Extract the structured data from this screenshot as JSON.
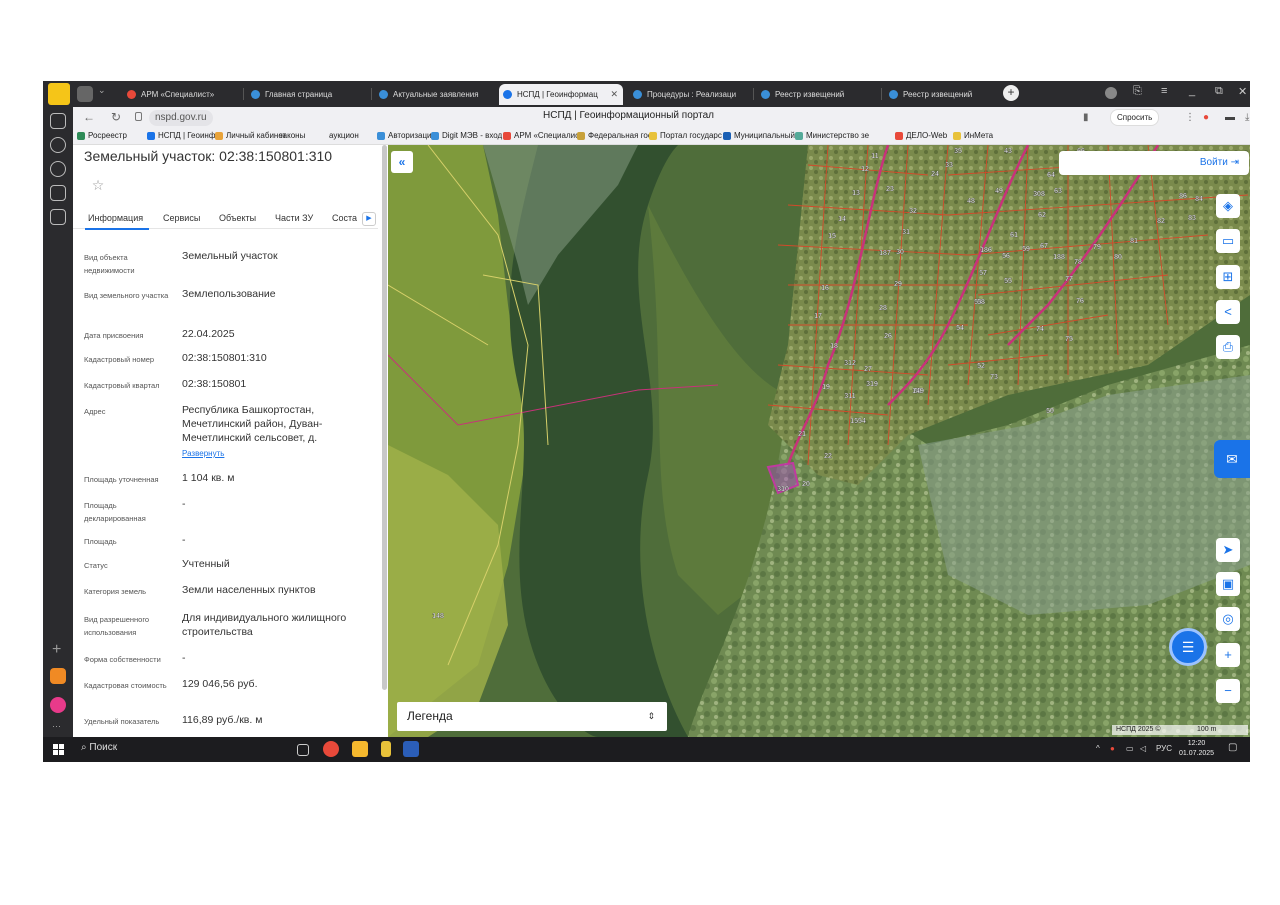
{
  "browser": {
    "tabs": [
      {
        "label": "АРМ «Специалист»",
        "color": "#e8493a"
      },
      {
        "label": "Главная страница",
        "color": "#3a8fd8"
      },
      {
        "label": "Актуальные заявления",
        "color": "#3a8fd8"
      },
      {
        "label": "НСПД | Геоинформац",
        "color": "#1a73e8",
        "active": true
      },
      {
        "label": "Процедуры : Реализаци",
        "color": "#3a8fd8"
      },
      {
        "label": "Реестр извещений",
        "color": "#3a8fd8"
      },
      {
        "label": "Реестр извещений",
        "color": "#3a8fd8"
      }
    ],
    "url": "nspd.gov.ru",
    "page_title": "НСПД | Геоинформационный портал",
    "ask_label": "Спросить",
    "bookmarks": [
      {
        "label": "Росреестр",
        "color": "#2e8b57"
      },
      {
        "label": "НСПД | Геоинфо",
        "color": "#1a73e8"
      },
      {
        "label": "Личный кабинет",
        "color": "#e8a33a"
      },
      {
        "label": "законы",
        "color": ""
      },
      {
        "label": "аукцион",
        "color": ""
      },
      {
        "label": "Авторизация",
        "color": "#3a8fd8"
      },
      {
        "label": "Digit МЭВ - вход",
        "color": "#3a8fd8"
      },
      {
        "label": "АРМ «Специалис",
        "color": "#e8493a"
      },
      {
        "label": "Федеральная гос",
        "color": "#c8a13a"
      },
      {
        "label": "Портал государс",
        "color": "#e8c23a"
      },
      {
        "label": "Муниципальный",
        "color": "#1a5fb4"
      },
      {
        "label": "Министерство зе",
        "color": "#5a9"
      },
      {
        "label": "ДЕЛО-Web",
        "color": "#e8493a"
      },
      {
        "label": "ИнМета",
        "color": "#e8c23a"
      }
    ]
  },
  "panel": {
    "title": "Земельный участок: 02:38:150801:310",
    "tabs": [
      "Информация",
      "Сервисы",
      "Объекты",
      "Части ЗУ",
      "Соста"
    ],
    "rows": [
      {
        "label": "Вид объекта недвижимости",
        "value": "Земельный участок"
      },
      {
        "label": "Вид земельного участка",
        "value": "Землепользование"
      },
      {
        "label": "Дата присвоения",
        "value": "22.04.2025"
      },
      {
        "label": "Кадастровый номер",
        "value": "02:38:150801:310"
      },
      {
        "label": "Кадастровый квартал",
        "value": "02:38:150801"
      },
      {
        "label": "Адрес",
        "value": "Республика Башкортостан, Мечетлинский район, Дуван-Мечетлинский сельсовет, д.",
        "expand": "Развернуть"
      },
      {
        "label": "Площадь уточненная",
        "value": "1 104 кв. м"
      },
      {
        "label": "Площадь декларированная",
        "value": "-"
      },
      {
        "label": "Площадь",
        "value": "-"
      },
      {
        "label": "Статус",
        "value": "Учтенный"
      },
      {
        "label": "Категория земель",
        "value": "Земли населенных пунктов"
      },
      {
        "label": "Вид разрешенного использования",
        "value": "Для индивидуального жилищного строительства"
      },
      {
        "label": "Форма собственности",
        "value": "-"
      },
      {
        "label": "Кадастровая стоимость",
        "value": "129 046,56 руб."
      },
      {
        "label": "Удельный показатель",
        "value": "116,89 руб./кв. м"
      }
    ]
  },
  "map": {
    "login_label": "Войти",
    "legend_label": "Легенда",
    "scale_label": "НСПД 2025 ©",
    "scale_distance": "100 m",
    "parcel_labels": [
      "11",
      "12",
      "13",
      "14",
      "15",
      "16",
      "17",
      "18",
      "19",
      "20",
      "21",
      "22",
      "23",
      "24",
      "26",
      "27",
      "28",
      "29",
      "30",
      "31",
      "32",
      "33",
      "35",
      "43",
      "48",
      "49",
      "50",
      "51",
      "52",
      "53",
      "54",
      "55",
      "56",
      "57",
      "58",
      "59",
      "61",
      "62",
      "63",
      "64",
      "65",
      "66",
      "67",
      "73",
      "74",
      "75",
      "76",
      "77",
      "78",
      "79",
      "80",
      "81",
      "82",
      "83",
      "84",
      "86",
      "149",
      "186",
      "187",
      "188",
      "308",
      "310",
      "311",
      "312",
      "319",
      "1554",
      "148"
    ]
  },
  "taskbar": {
    "search_label": "Поиск",
    "lang": "РУС",
    "time": "12:20",
    "date": "01.07.2025"
  }
}
